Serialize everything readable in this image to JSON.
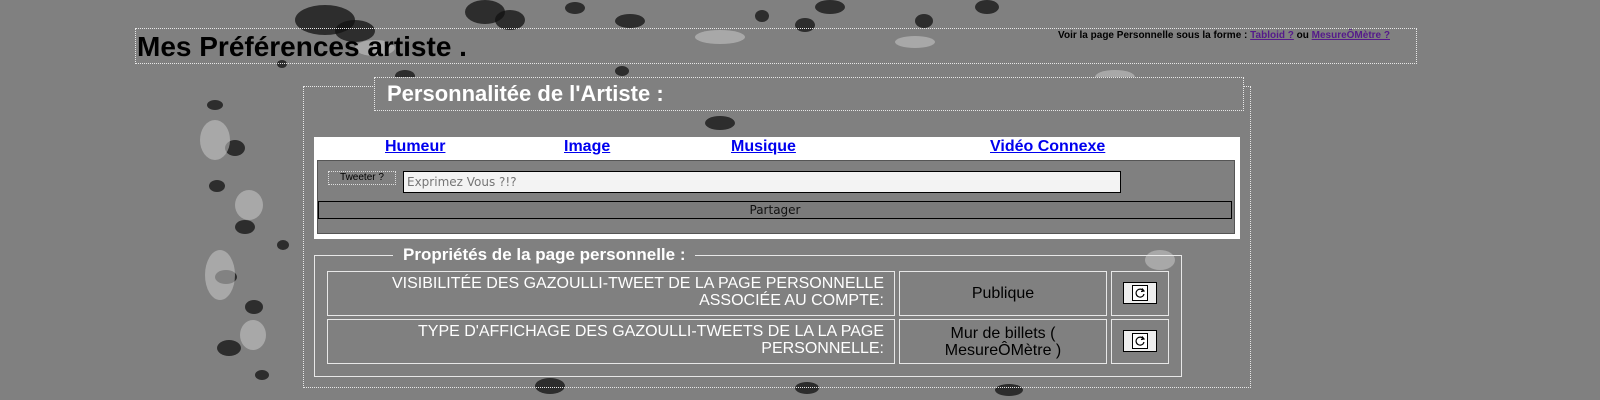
{
  "header": {
    "title": "Mes Préférences artiste .",
    "view_as_prefix": "Voir la page Personnelle sous la forme : ",
    "view_as_link1": "Tabloid ?",
    "view_as_separator": " ou ",
    "view_as_link2": "MesureÔMètre ?"
  },
  "personality": {
    "title": "Personnalitée de l'Artiste :",
    "tabs": [
      "Humeur",
      "Image",
      "Musique",
      "Vidéo Connexe"
    ]
  },
  "tweet": {
    "label": "Tweeter ?",
    "placeholder": "Exprimez Vous ?!?",
    "share_label": "Partager"
  },
  "properties": {
    "title": "Propriétés de la page personnelle :",
    "rows": [
      {
        "label": "VISIBILITÉE DES GAZOULLI-TWEET DE LA PAGE PERSONNELLE ASSOCIÉE AU COMPTE:",
        "value": "Publique",
        "action_icon": "refresh-icon"
      },
      {
        "label": "TYPE D'AFFICHAGE DES GAZOULLI-TWEETS DE LA LA PAGE PERSONNELLE:",
        "value": "Mur de billets ( MesureÔMètre )",
        "action_icon": "refresh-icon"
      }
    ]
  },
  "colors": {
    "background": "#808080",
    "link": "#0000ee",
    "visited_link": "#551a8b",
    "heading": "#ffffff"
  }
}
